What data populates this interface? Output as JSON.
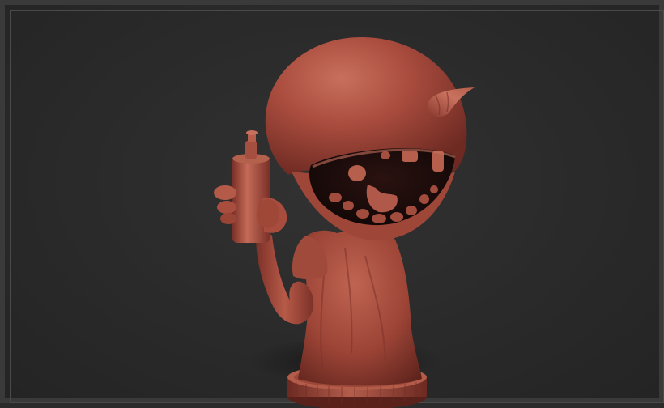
{
  "viewport": {
    "background": "#2b2b2b",
    "border": "#3a3a3a"
  },
  "model": {
    "material_color": "#a84a3c",
    "highlight_color": "#c8705f",
    "shadow_color": "#6a2a22",
    "mouth_color": "#1a0c0a"
  }
}
